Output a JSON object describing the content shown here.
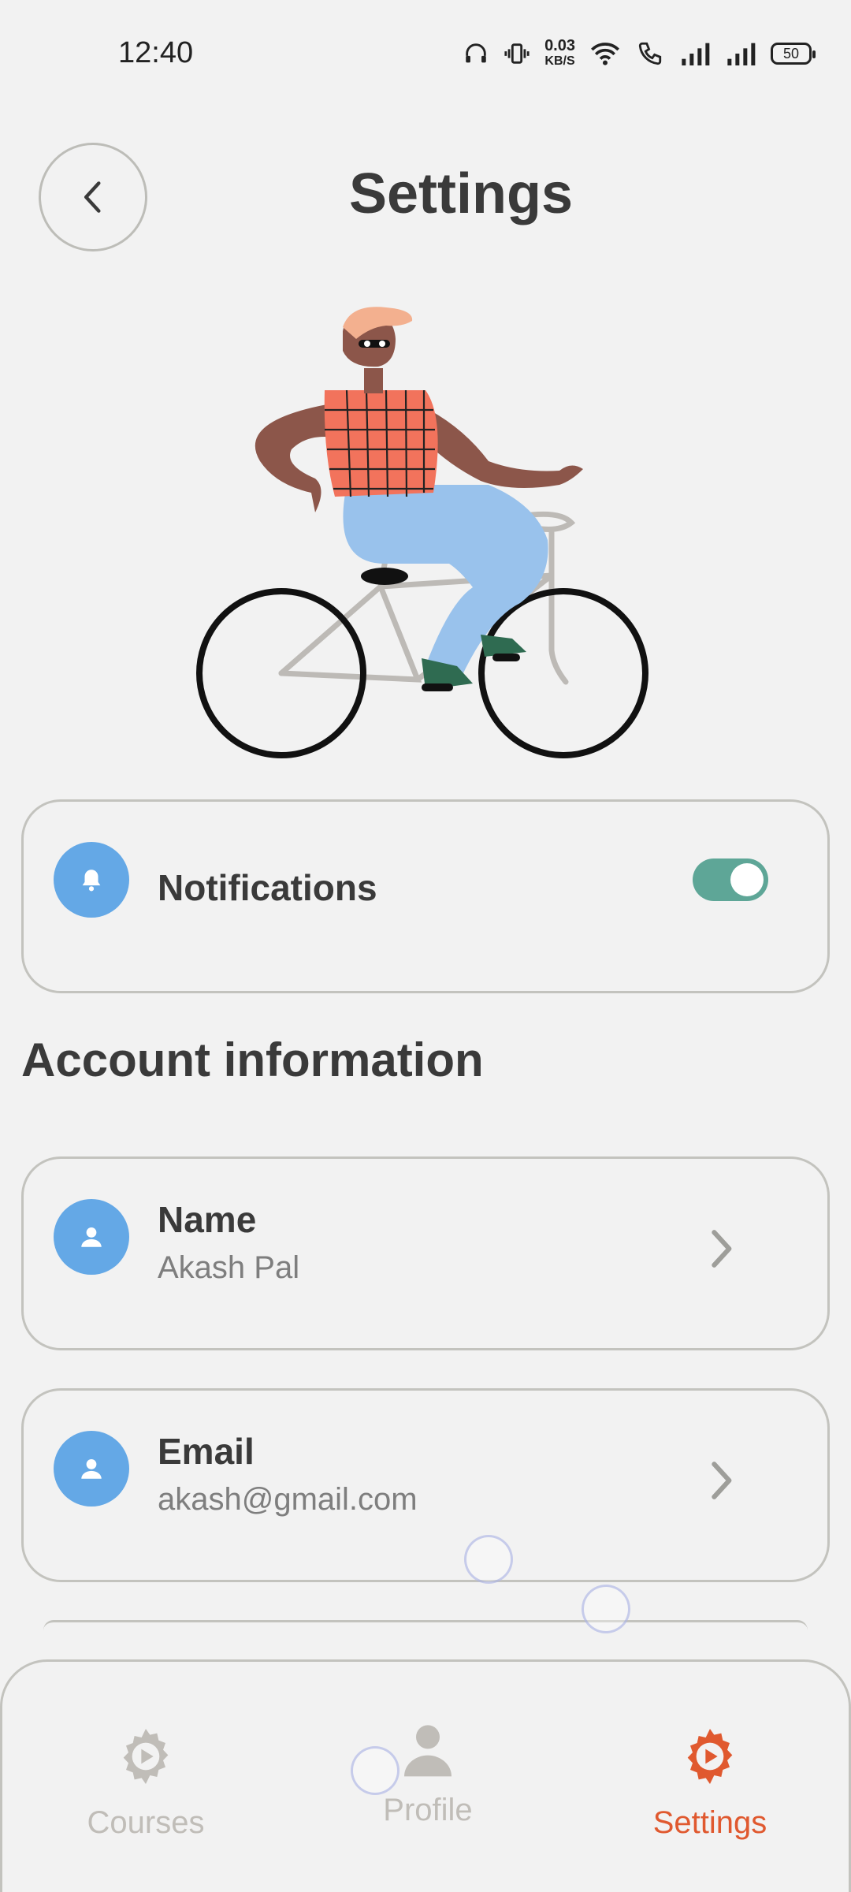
{
  "status_bar": {
    "time": "12:40",
    "net_speed_value": "0.03",
    "net_speed_unit": "KB/S",
    "battery": "50"
  },
  "header": {
    "title": "Settings",
    "back_icon": "chevron-left-icon"
  },
  "notifications": {
    "label": "Notifications",
    "enabled": true,
    "icon": "bell-icon"
  },
  "account": {
    "heading": "Account information",
    "items": [
      {
        "label": "Name",
        "value": "Akash Pal",
        "icon": "user-icon"
      },
      {
        "label": "Email",
        "value": "akash@gmail.com",
        "icon": "user-icon"
      }
    ]
  },
  "nav": {
    "items": [
      {
        "label": "Courses",
        "icon": "gear-play-icon",
        "active": false
      },
      {
        "label": "Profile",
        "icon": "person-icon",
        "active": false
      },
      {
        "label": "Settings",
        "icon": "gear-play-icon",
        "active": true
      }
    ]
  },
  "colors": {
    "accent": "#e0592f",
    "toggle_on": "#5ea697",
    "icon_circle": "#64a8e6",
    "inactive_nav": "#c0bdb8",
    "background": "#f2f2f2"
  }
}
